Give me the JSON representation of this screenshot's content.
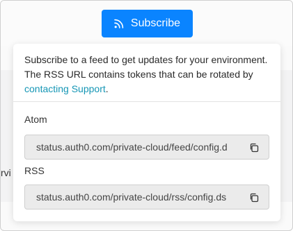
{
  "header": {
    "subscribe_label": "Subscribe",
    "subscribe_icon": "rss-icon"
  },
  "background": {
    "partial_text": "rvi"
  },
  "popover": {
    "description_text": "Subscribe to a feed to get updates for your environment. The RSS URL contains tokens that can be rotated by ",
    "support_link": "contacting Support",
    "support_link_suffix": ".",
    "feeds": [
      {
        "label": "Atom",
        "url": "status.auth0.com/private-cloud/feed/config.d",
        "copy_icon": "copy-icon"
      },
      {
        "label": "RSS",
        "url": "status.auth0.com/private-cloud/rss/config.ds",
        "copy_icon": "copy-icon"
      }
    ]
  },
  "colors": {
    "accent": "#0a84ff",
    "link": "#1596b5"
  }
}
